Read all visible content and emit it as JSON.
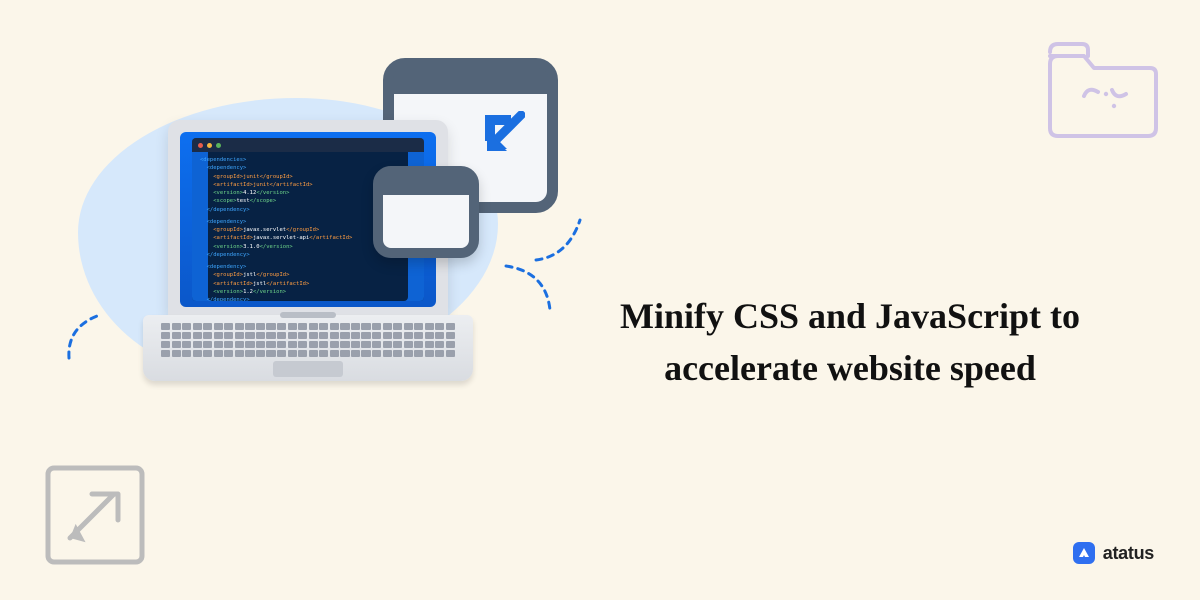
{
  "headline": "Minify CSS and JavaScript to accelerate website speed",
  "brand": {
    "name": "atatus"
  },
  "decorative_icons": {
    "top_right": "code-folder-icon",
    "bottom_left": "popout-arrow-icon"
  },
  "illustration": {
    "laptop_code": {
      "line1_open": "<dependencies>",
      "b1_l1a": "<dependency>",
      "b1_l2": "<groupId>junit</groupId>",
      "b1_l3": "<artifactId>junit</artifactId>",
      "b1_l4a": "<version>",
      "b1_l4b": "4.12",
      "b1_l4c": "</version>",
      "b1_l5a": "<scope>",
      "b1_l5b": "test",
      "b1_l5c": "</scope>",
      "b1_l6": "</dependency>",
      "b2_l1": "<dependency>",
      "b2_l2a": "<groupId>",
      "b2_l2b": "javax.servlet",
      "b2_l2c": "</groupId>",
      "b2_l3a": "<artifactId>",
      "b2_l3b": "javax.servlet-api",
      "b2_l3c": "</artifactId>",
      "b2_l4a": "<version>",
      "b2_l4b": "3.1.0",
      "b2_l4c": "</version>",
      "b2_l5": "</dependency>",
      "b3_l1": "<dependency>",
      "b3_l2a": "<groupId>",
      "b3_l2b": "jstl",
      "b3_l2c": "</groupId>",
      "b3_l3a": "<artifactId>",
      "b3_l3b": "jstl",
      "b3_l3c": "</artifactId>",
      "b3_l4a": "<version>",
      "b3_l4b": "1.2",
      "b3_l4c": "</version>",
      "b3_l5": "</dependency>"
    }
  }
}
